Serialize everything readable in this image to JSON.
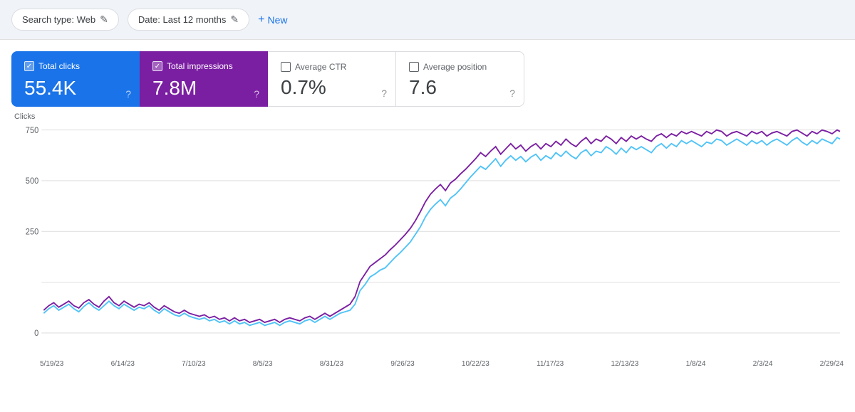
{
  "topbar": {
    "searchType": "Search type: Web",
    "dateRange": "Date: Last 12 months",
    "newLabel": "New",
    "editIcon": "✎"
  },
  "metrics": [
    {
      "id": "total-clicks",
      "label": "Total clicks",
      "value": "55.4K",
      "type": "active-blue",
      "checked": true
    },
    {
      "id": "total-impressions",
      "label": "Total impressions",
      "value": "7.8M",
      "type": "active-purple",
      "checked": true
    },
    {
      "id": "average-ctr",
      "label": "Average CTR",
      "value": "0.7%",
      "type": "inactive",
      "checked": false
    },
    {
      "id": "average-position",
      "label": "Average position",
      "value": "7.6",
      "type": "inactive",
      "checked": false
    }
  ],
  "chart": {
    "yAxisLabel": "Clicks",
    "yAxisValues": [
      "750",
      "500",
      "250",
      "0"
    ],
    "xAxisLabels": [
      "5/19/23",
      "6/14/23",
      "7/10/23",
      "8/5/23",
      "8/31/23",
      "9/26/23",
      "10/22/23",
      "11/17/23",
      "12/13/23",
      "1/8/24",
      "2/3/24",
      "2/29/24"
    ],
    "colors": {
      "blue": "#4fc3f7",
      "purple": "#7b1fa2"
    }
  }
}
